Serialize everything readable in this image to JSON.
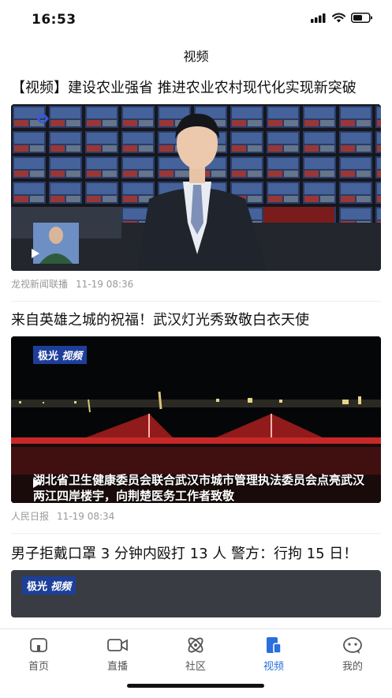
{
  "status_bar": {
    "time": "16:53"
  },
  "nav": {
    "title": "视频"
  },
  "feed": [
    {
      "title": "【视频】建设农业强省 推进农业农村现代化实现新突破",
      "source": "龙视新闻联播",
      "time": "11-19 08:36"
    },
    {
      "title": "来自英雄之城的祝福！武汉灯光秀致敬白衣天使",
      "source": "人民日报",
      "time": "11-19 08:34",
      "badge": {
        "a": "极光",
        "b": "视频"
      },
      "caption": "湖北省卫生健康委员会联合武汉市城市管理执法委员会点亮武汉两江四岸楼宇，向荆楚医务工作者致敬"
    },
    {
      "title": "男子拒戴口罩 3 分钟内殴打 13 人 警方：行拘 15 日！",
      "badge": {
        "a": "极光",
        "b": "视频"
      }
    }
  ],
  "tabbar": [
    {
      "label": "首页",
      "icon": "home-icon"
    },
    {
      "label": "直播",
      "icon": "live-camera-icon"
    },
    {
      "label": "社区",
      "icon": "community-icon"
    },
    {
      "label": "视频",
      "icon": "video-icon",
      "active": true
    },
    {
      "label": "我的",
      "icon": "profile-icon"
    }
  ],
  "colors": {
    "accent": "#2a6fdb",
    "badge": "#1d3f9a"
  }
}
